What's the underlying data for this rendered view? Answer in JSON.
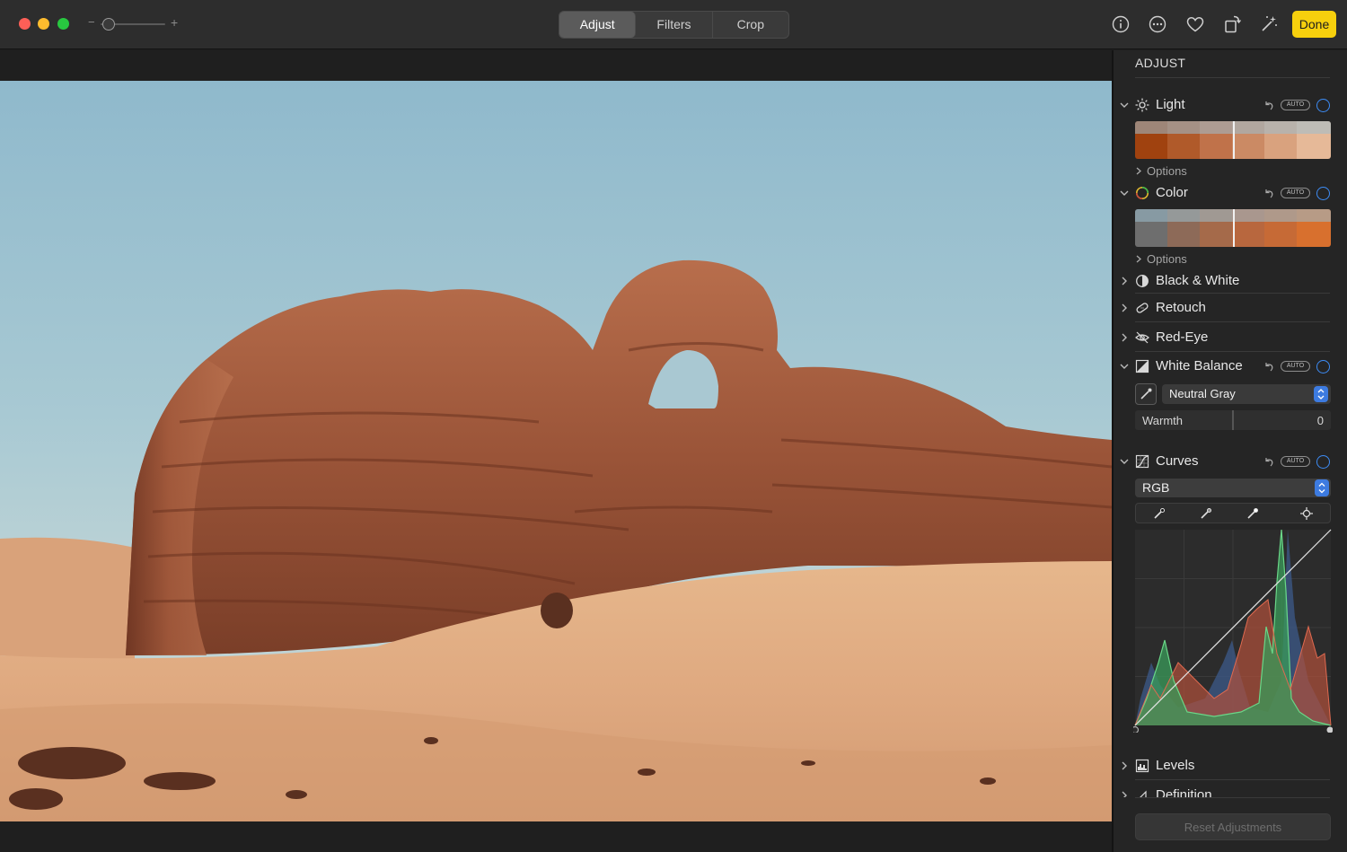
{
  "window": {
    "zoom_minus": "−",
    "zoom_plus": "+"
  },
  "toolbar": {
    "tabs": [
      {
        "label": "Adjust",
        "active": true
      },
      {
        "label": "Filters",
        "active": false
      },
      {
        "label": "Crop",
        "active": false
      }
    ],
    "icons": [
      "info-icon",
      "more-icon",
      "heart-icon",
      "rotate-icon",
      "auto-enhance-icon"
    ],
    "done_label": "Done",
    "done_color": "#f7d00d"
  },
  "sidebar": {
    "title": "ADJUST",
    "auto_label": "AUTO",
    "accent_color": "#3d8cf5",
    "sections": {
      "light": {
        "label": "Light",
        "options": "Options"
      },
      "color": {
        "label": "Color",
        "options": "Options"
      },
      "bw": {
        "label": "Black & White"
      },
      "retouch": {
        "label": "Retouch"
      },
      "redeye": {
        "label": "Red-Eye"
      },
      "wb": {
        "label": "White Balance",
        "mode": "Neutral Gray",
        "warmth_label": "Warmth",
        "warmth_value": "0"
      },
      "curves": {
        "label": "Curves",
        "channel": "RGB"
      },
      "levels": {
        "label": "Levels"
      },
      "definition": {
        "label": "Definition"
      }
    },
    "reset_label": "Reset Adjustments"
  }
}
